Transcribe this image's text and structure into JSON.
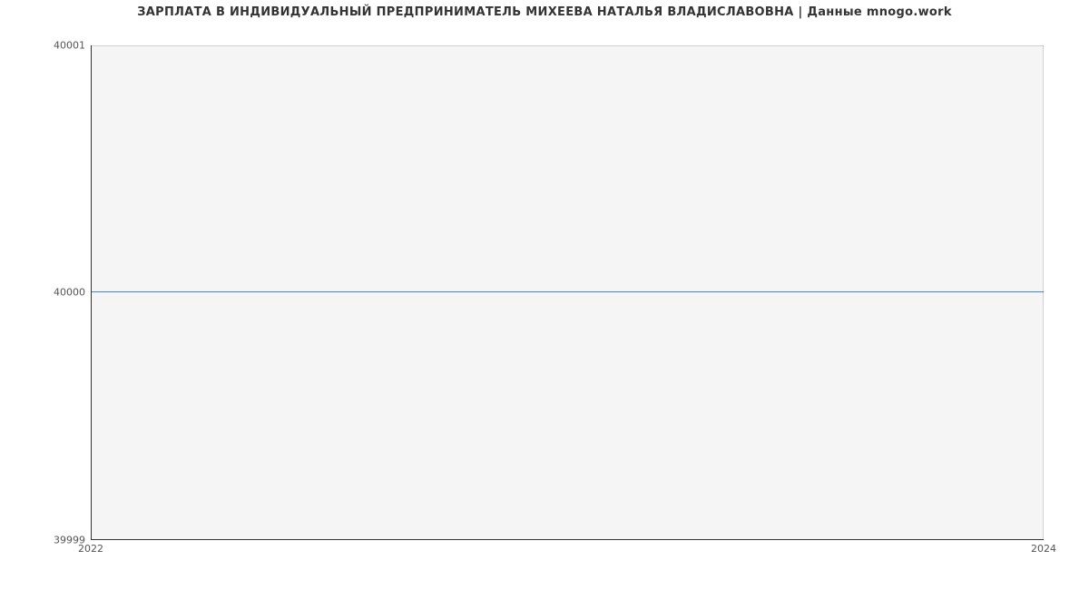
{
  "chart_data": {
    "type": "line",
    "title": "ЗАРПЛАТА В ИНДИВИДУАЛЬНЫЙ ПРЕДПРИНИМАТЕЛЬ МИХЕЕВА НАТАЛЬЯ ВЛАДИСЛАВОВНА | Данные mnogo.work",
    "x": [
      2022,
      2024
    ],
    "y": [
      40000,
      40000
    ],
    "xlabel": "",
    "ylabel": "",
    "x_ticks": [
      "2022",
      "2024"
    ],
    "y_ticks": [
      "39999",
      "40000",
      "40001"
    ],
    "xlim": [
      2022,
      2024
    ],
    "ylim": [
      39999,
      40001
    ],
    "grid": true,
    "line_color": "#3b7dd8"
  }
}
